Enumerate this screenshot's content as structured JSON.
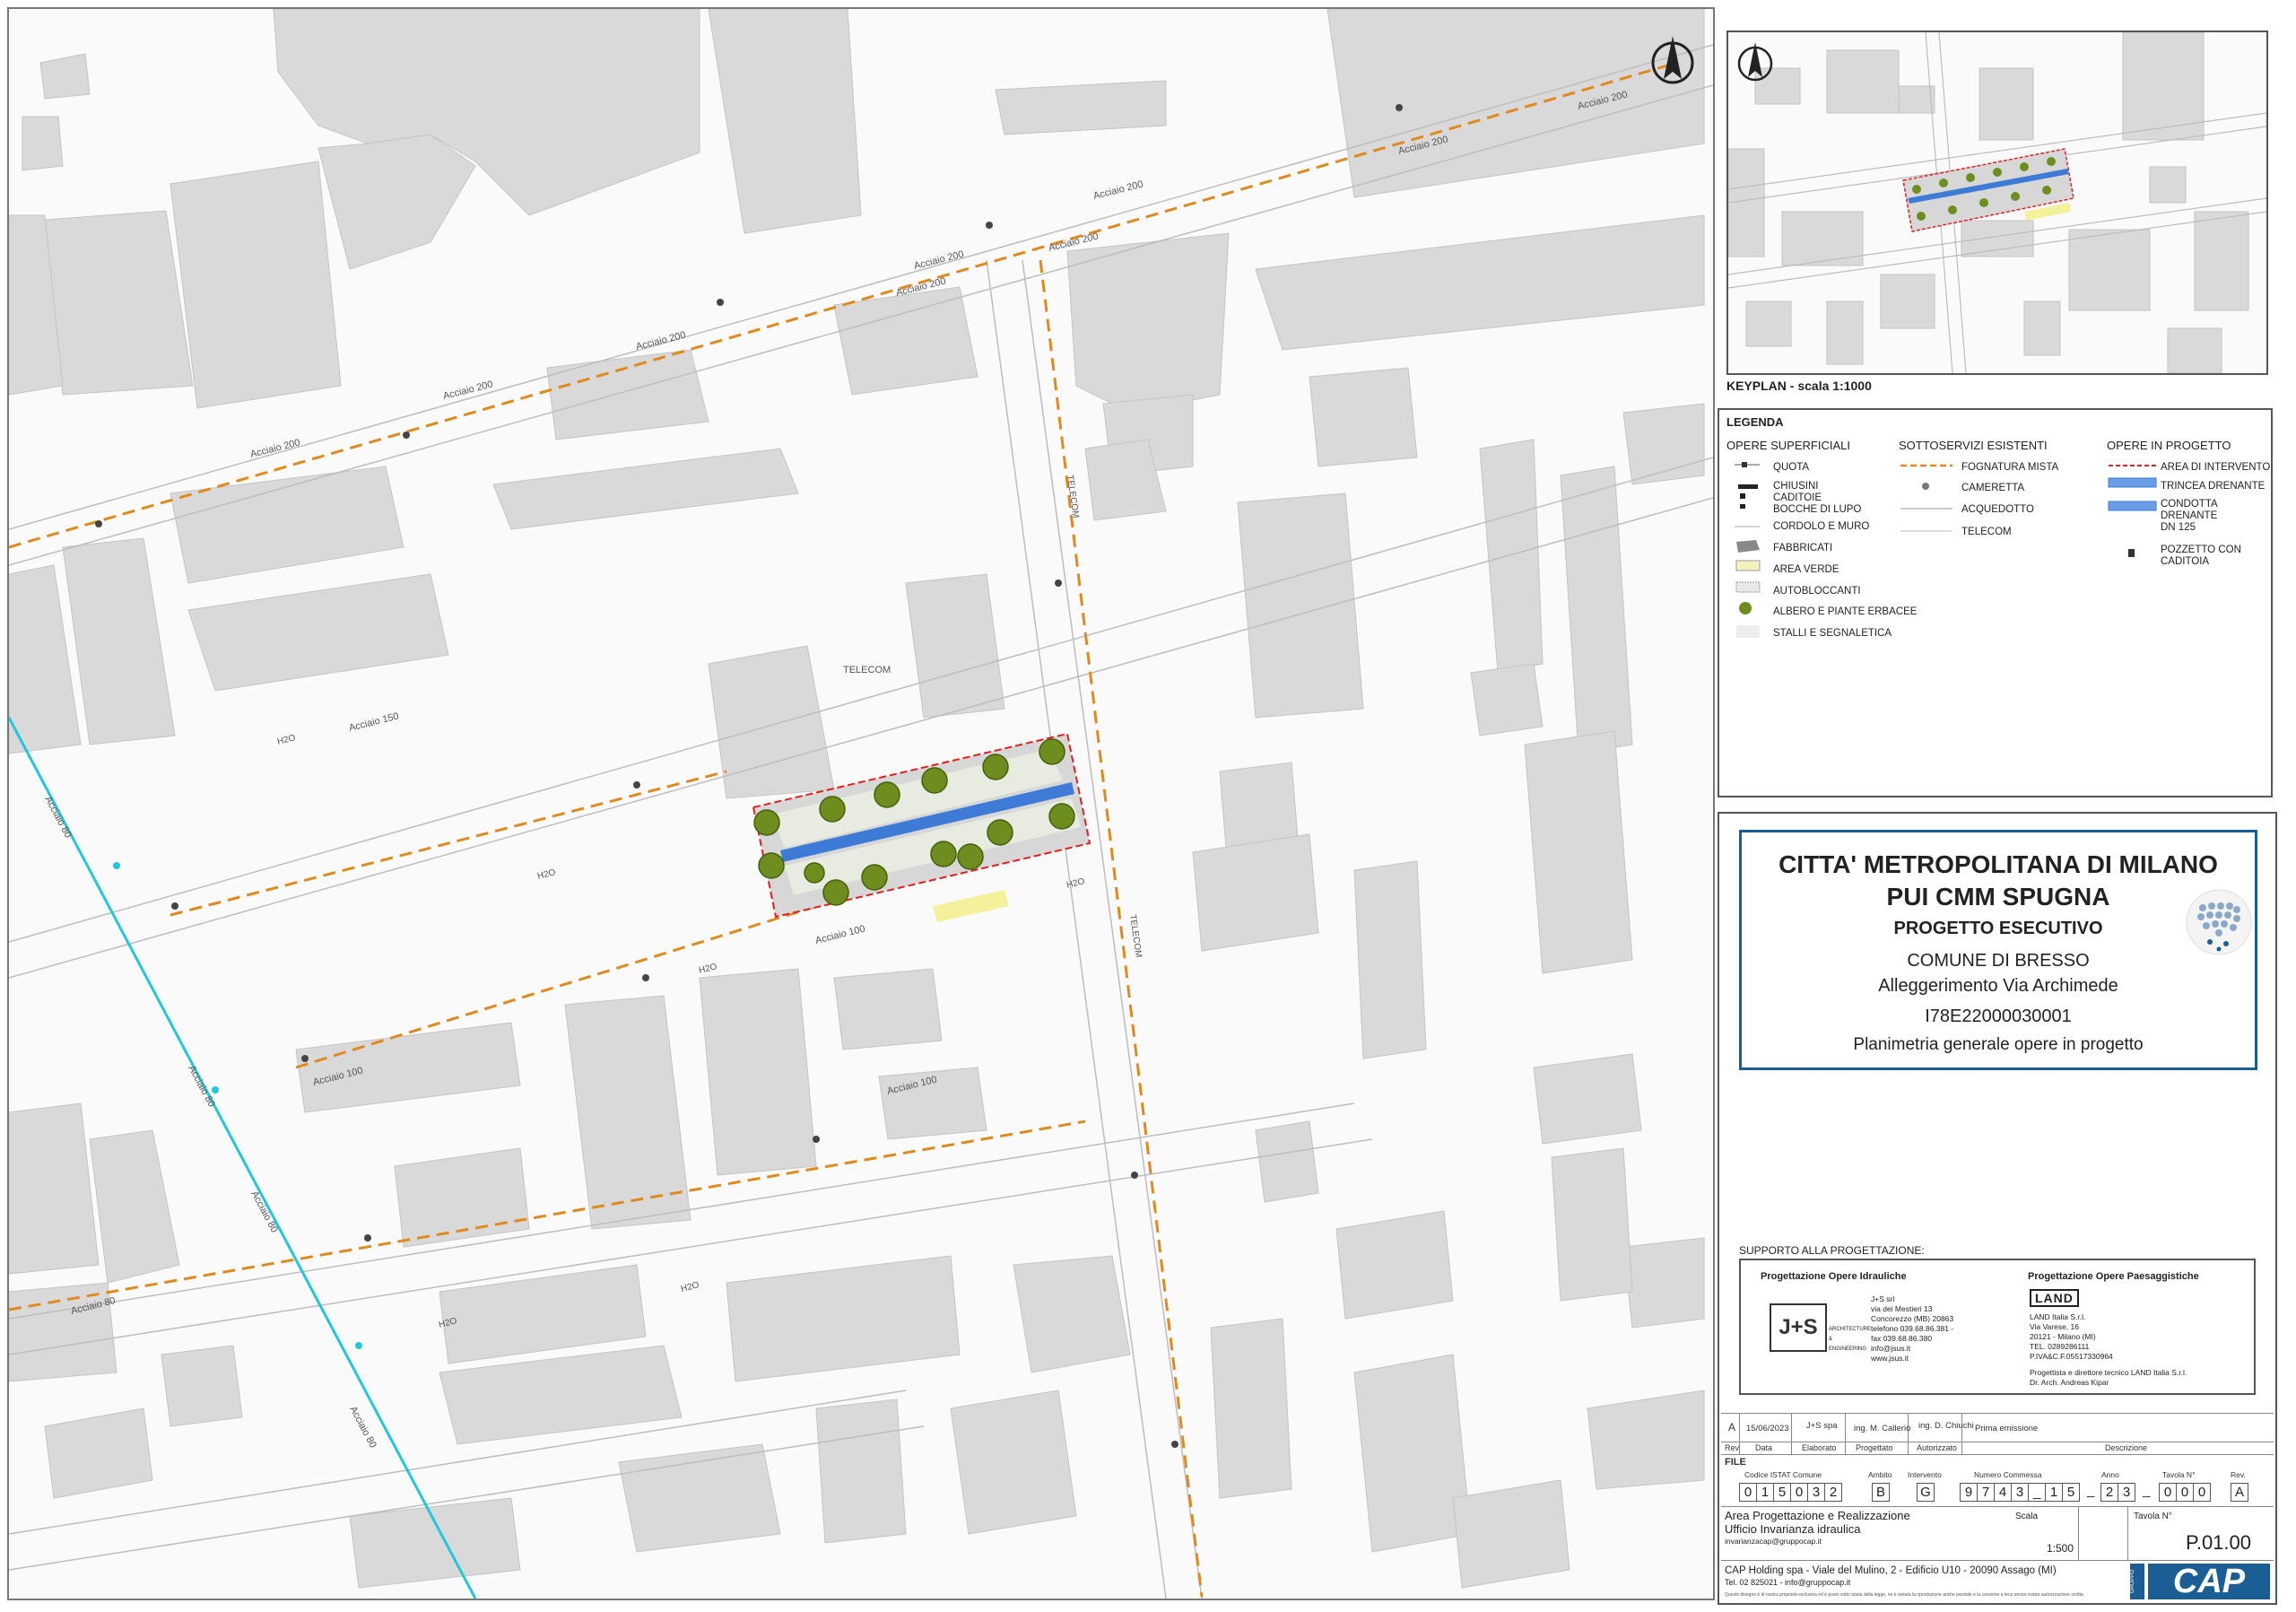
{
  "map": {
    "street_labels": [
      "Acciaio 200",
      "Acciaio 150",
      "Acciaio 100",
      "Acciaio 80"
    ],
    "conduit_label": "H2O",
    "cable_label": "TELECOM",
    "telecom_label": "TELECOM"
  },
  "keyplan": {
    "title": "KEYPLAN - scala 1:1000"
  },
  "legend": {
    "title": "LEGENDA",
    "col1_title": "OPERE SUPERFICIALI",
    "col2_title": "SOTTOSERVIZI ESISTENTI",
    "col3_title": "OPERE IN PROGETTO",
    "col1": [
      "QUOTA",
      "CHIUSINI",
      "CADITOIE",
      "BOCCHE DI LUPO",
      "CORDOLO E MURO",
      "FABBRICATI",
      "AREA VERDE",
      "AUTOBLOCCANTI",
      "ALBERO E PIANTE ERBACEE",
      "STALLI E SEGNALETICA"
    ],
    "col2": [
      "FOGNATURA MISTA",
      "CAMERETTA",
      "ACQUEDOTTO",
      "TELECOM"
    ],
    "col3": [
      "AREA DI INTERVENTO",
      "TRINCEA DRENANTE",
      "CONDOTTA",
      "DRENANTE",
      "DN 125",
      "POZZETTO CON",
      "CADITOIA"
    ]
  },
  "titleblock": {
    "line1": "CITTA' METROPOLITANA DI MILANO",
    "line2": "PUI CMM SPUGNA",
    "line3": "PROGETTO ESECUTIVO",
    "line4": "COMUNE DI BRESSO",
    "line5": "Alleggerimento Via Archimede",
    "line6": "I78E22000030001",
    "line7": "Planimetria generale opere in progetto",
    "support_title": "SUPPORTO ALLA PROGETTAZIONE:",
    "left_heading": "Progettazione Opere Idrauliche",
    "left_logo": "J+S",
    "left_logo_sub": "ARCHITECTURE & ENGINEERING",
    "left_lines": [
      "J+S srl",
      "via dei Mestieri 13",
      "Concorezzo (MB) 20863",
      "telefono 039.68.86.381 -",
      "fax 039.68.86.380",
      "info@jsus.it",
      "www.jsus.it"
    ],
    "right_heading": "Progettazione Opere Paesaggistiche",
    "right_logo": "LAND",
    "right_lines": [
      "LAND Italia S.r.l.",
      "Via Varese, 16",
      "20121 - Milano (MI)",
      "TEL. 0289286111",
      "P.IVA&C.F.05517330964"
    ],
    "right_note1": "Progettista e direttore tecnico LAND Italia S.r.l.",
    "right_note2": "Dr. Arch. Andreas Kipar",
    "rev_row": [
      "A",
      "15/06/2023",
      "J+S spa",
      "ing. M. Callerio",
      "ing. D. Chiuchi",
      "Prima emissione"
    ],
    "rev_headers": [
      "Rev",
      "Data",
      "Elaborato",
      "Progettato",
      "Autorizzato",
      "Descrizione"
    ],
    "file_label": "FILE",
    "code_headers": [
      "Codice ISTAT Comune",
      "Ambito",
      "Intervento",
      "Numero Commessa",
      "Anno",
      "Tavola N°",
      "Rev."
    ],
    "istat": [
      "0",
      "1",
      "5",
      "0",
      "3",
      "2"
    ],
    "ambito": "B",
    "intervento": "G",
    "commessa": [
      "9",
      "7",
      "4",
      "3",
      "_",
      "1",
      "5"
    ],
    "anno": [
      "2",
      "3"
    ],
    "tavola": [
      "0",
      "0",
      "0"
    ],
    "rev": "A",
    "sep": "_",
    "area_line1": "Area Progettazione e Realizzazione",
    "area_line2": "Ufficio Invarianza idraulica",
    "area_email": "invarianzacap@gruppocap.it",
    "scala_label": "Scala",
    "scala_value": "1:500",
    "tavola_label": "Tavola N°",
    "tavola_value": "P.01.00",
    "cap_address": "CAP Holding spa - Viale del Mulino, 2 - Edificio U10 - 20090 Assago (MI)",
    "cap_contacts": "Tel. 02 825021 - info@gruppocap.it",
    "cap_logo": "CAP",
    "cap_logo_small": "GRUPPO",
    "disclaimer": "Questo disegno è di nostra proprietà esclusiva ed è posto sotto tutela della legge, ne è vietata la riproduzione anche parziale e la cessione a terzi senza nostra autorizzazione scritta."
  },
  "colors": {
    "accent": "#1b5e95",
    "sewer": "#e08a1e",
    "water": "#20c8d8",
    "intervention": "#e02020",
    "building": "#d9d9d9"
  }
}
